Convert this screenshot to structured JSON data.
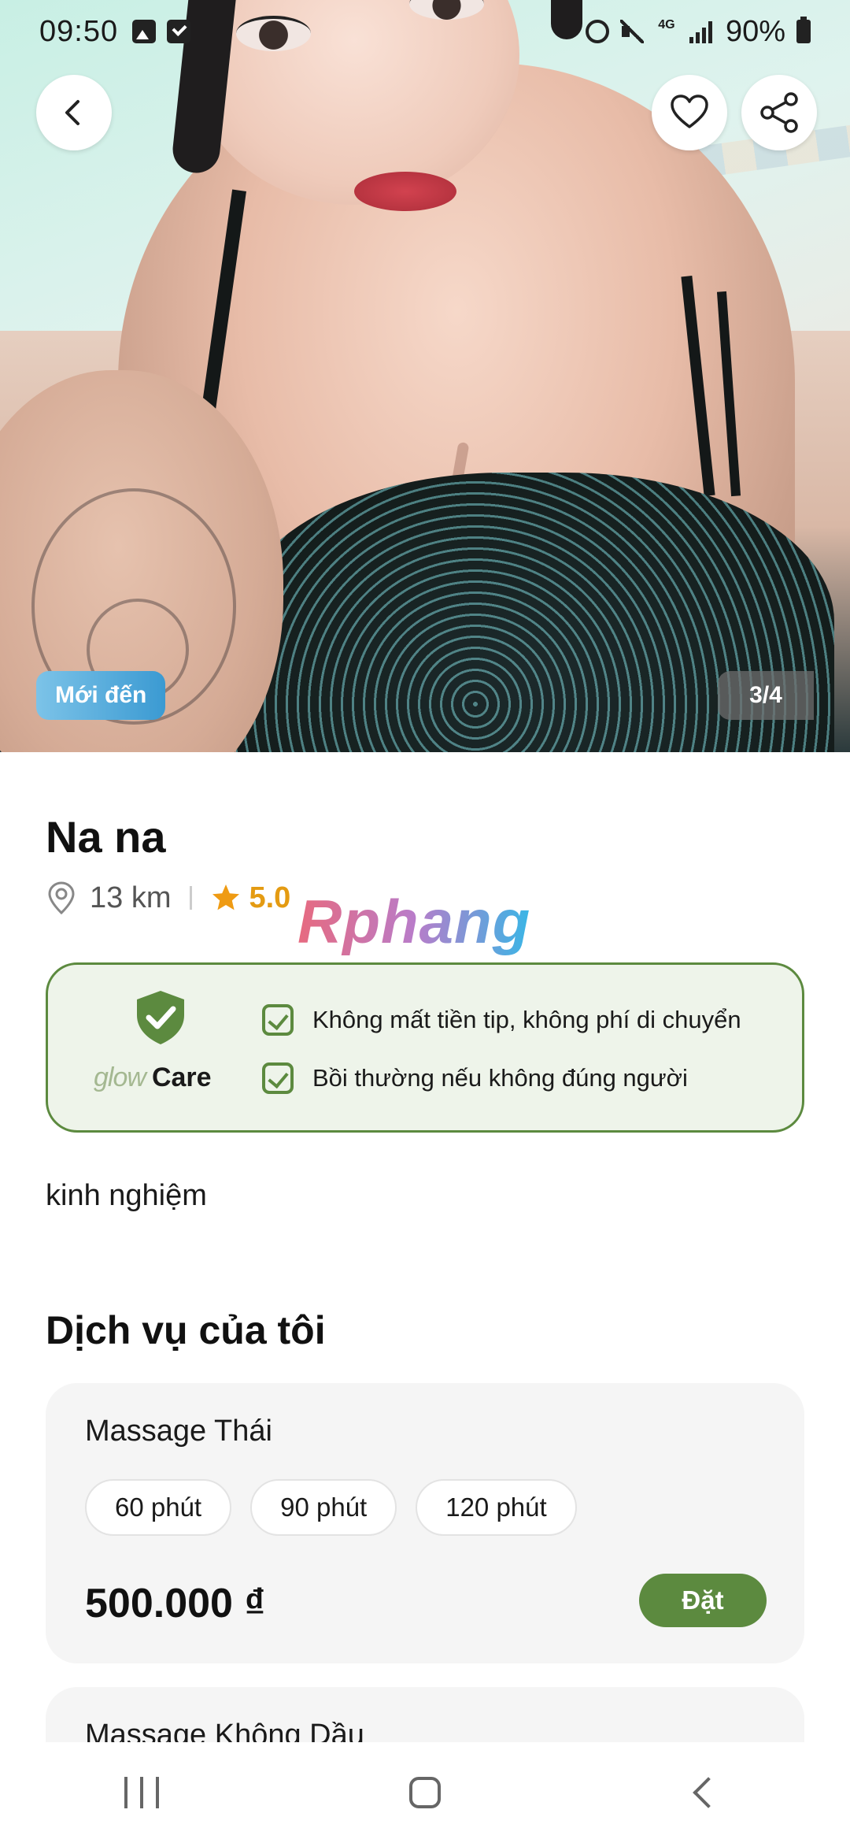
{
  "status_bar": {
    "time": "09:50",
    "network": "4G",
    "battery": "90%"
  },
  "hero": {
    "badge": "Mới đến",
    "counter": "3/4"
  },
  "profile": {
    "name": "Na na",
    "distance": "13 km",
    "rating": "5.0",
    "watermark": "Rphang"
  },
  "care": {
    "brand_glow": "glow",
    "brand_care": "Care",
    "items": [
      "Không mất tiền tip, không phí di chuyển",
      "Bồi thường nếu không đúng người"
    ]
  },
  "description": "kinh nghiệm",
  "services_title": "Dịch vụ của tôi",
  "services": [
    {
      "name": "Massage Thái",
      "durations": [
        "60 phút",
        "90 phút",
        "120 phút"
      ],
      "price": "500.000 ₫",
      "book_label": "Đặt"
    },
    {
      "name": "Massage Không Dầu"
    }
  ],
  "colors": {
    "accent_green": "#5c8a3f",
    "rating_orange": "#e49b12",
    "badge_blue": "#3b9ad2"
  }
}
